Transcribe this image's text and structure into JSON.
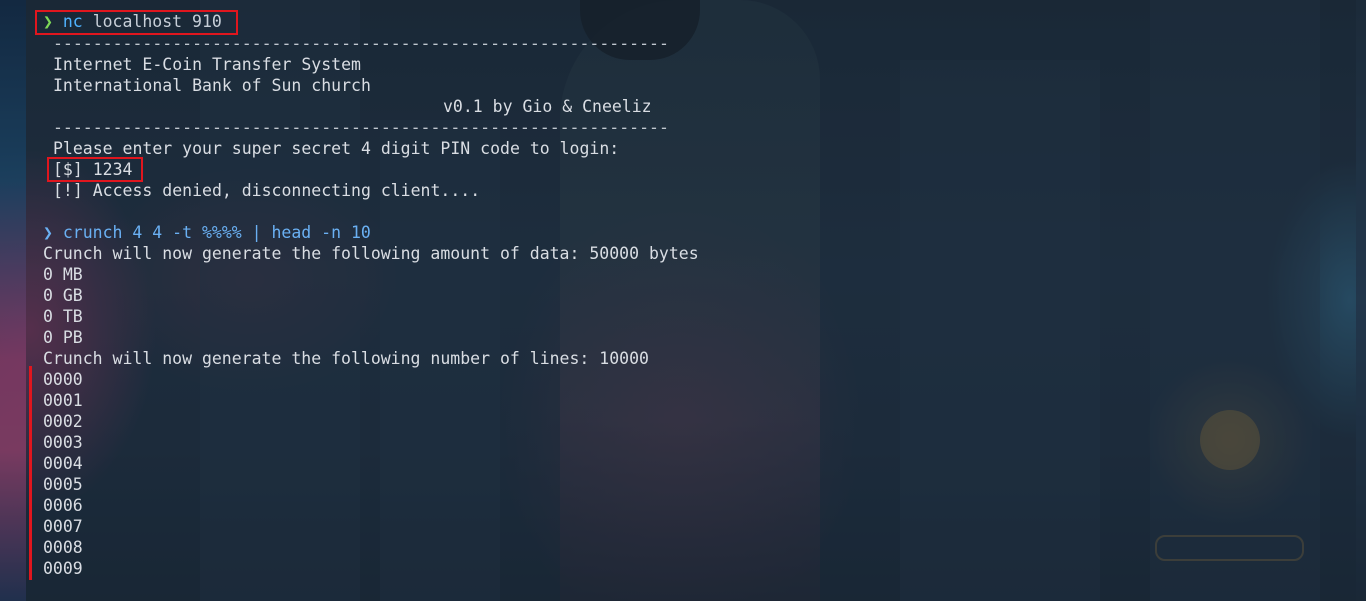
{
  "session1": {
    "prompt_symbol": "❯",
    "command": "nc",
    "args": "localhost 910",
    "separator_top": "--------------------------------------------------------------",
    "title1": "Internet E-Coin Transfer System",
    "title2": "International Bank of Sun church",
    "version": "v0.1 by Gio & Cneeliz",
    "separator_bottom": "--------------------------------------------------------------",
    "pin_prompt": "Please enter your super secret 4 digit PIN code to login:",
    "input_line": "[$] 1234",
    "result_line": "[!] Access denied, disconnecting client...."
  },
  "session2": {
    "prompt_symbol": "❯",
    "command": "crunch 4 4 -t %%%% | head -n 10",
    "data_amount_line": "Crunch will now generate the following amount of data: 50000 bytes",
    "size_lines": [
      "0 MB",
      "0 GB",
      "0 TB",
      "0 PB"
    ],
    "lines_count_line": "Crunch will now generate the following number of lines: 10000",
    "output": [
      "0000",
      "0001",
      "0002",
      "0003",
      "0004",
      "0005",
      "0006",
      "0007",
      "0008",
      "0009"
    ]
  },
  "colors": {
    "highlight": "#e0161e",
    "prompt_green": "#7ed957",
    "command_blue": "#4fb3ff",
    "text": "#d9dde3"
  }
}
